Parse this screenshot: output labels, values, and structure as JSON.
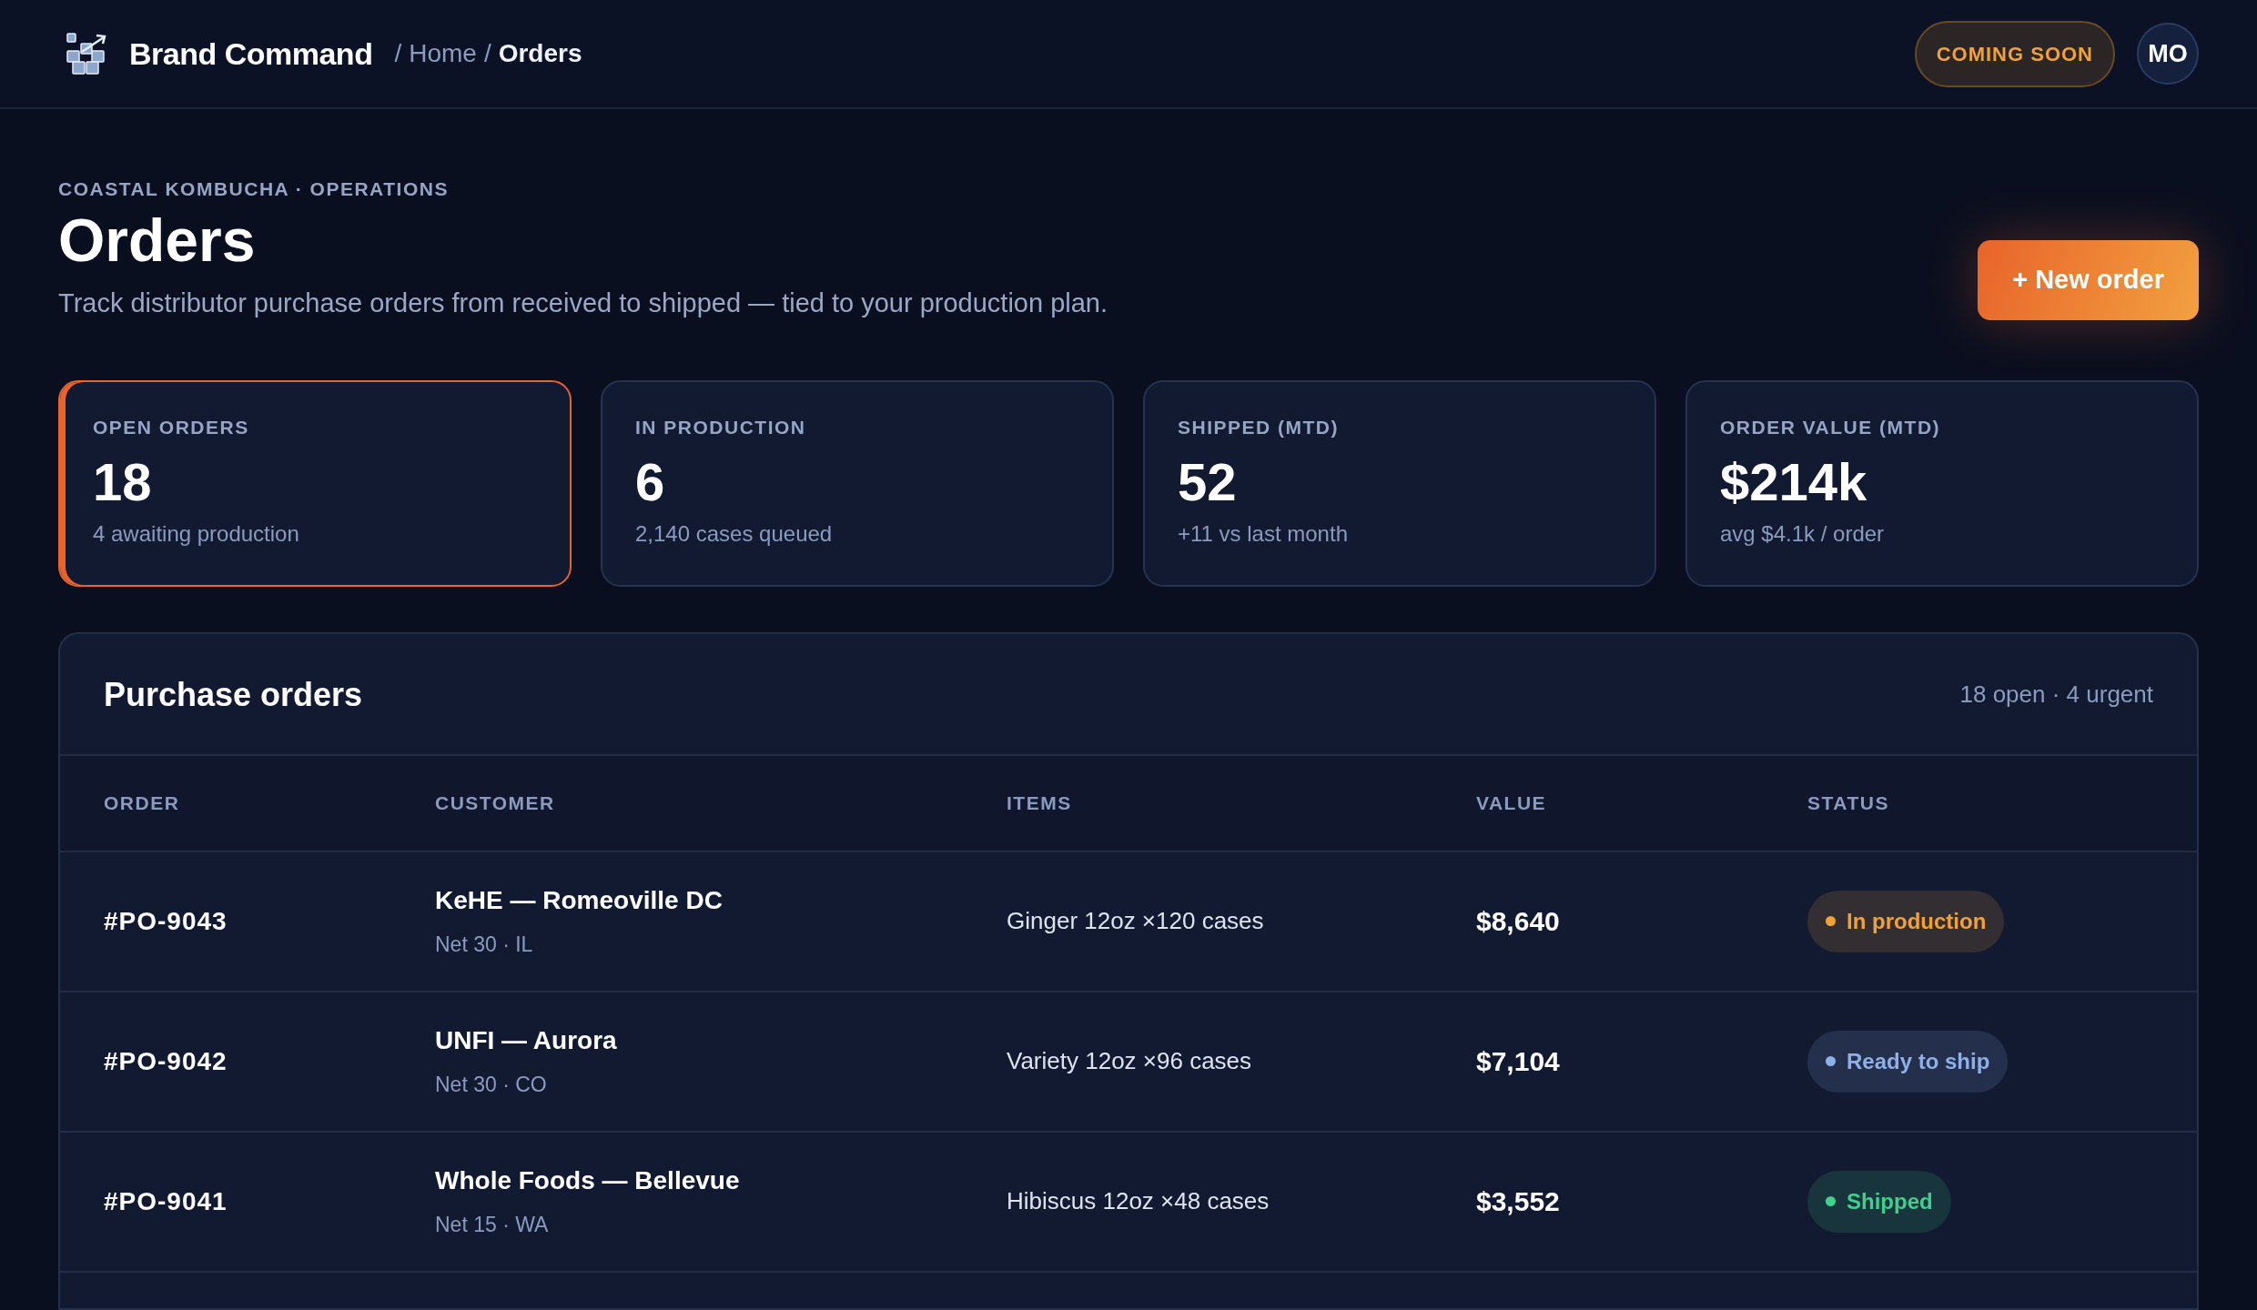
{
  "header": {
    "brand": "Brand Command",
    "breadcrumb": [
      {
        "separator": "/",
        "label": "Home",
        "current": false
      },
      {
        "separator": "/",
        "label": "Orders",
        "current": true
      }
    ],
    "badge": "COMING SOON",
    "avatar": "MO"
  },
  "page": {
    "eyebrow": "COASTAL KOMBUCHA · OPERATIONS",
    "title": "Orders",
    "subtitle": "Track distributor purchase orders from received to shipped — tied to your production plan.",
    "action": "+ New order"
  },
  "kpis": [
    {
      "label": "OPEN ORDERS",
      "value": "18",
      "note": "4 awaiting production",
      "selected": true
    },
    {
      "label": "IN PRODUCTION",
      "value": "6",
      "note": "2,140 cases queued",
      "selected": false
    },
    {
      "label": "SHIPPED (MTD)",
      "value": "52",
      "note": "+11 vs last month",
      "selected": false
    },
    {
      "label": "ORDER VALUE (MTD)",
      "value": "$214k",
      "note": "avg $4.1k / order",
      "selected": false
    }
  ],
  "table": {
    "title": "Purchase orders",
    "summary": "18 open · 4 urgent",
    "columns": [
      "ORDER",
      "CUSTOMER",
      "ITEMS",
      "VALUE",
      "STATUS"
    ],
    "rows": [
      {
        "order": "#PO-9043",
        "customer": "KeHE — Romeoville DC",
        "terms": "Net 30 · IL",
        "items": "Ginger 12oz ×120 cases",
        "value": "$8,640",
        "status": "In production",
        "color": "#f0a23a"
      },
      {
        "order": "#PO-9042",
        "customer": "UNFI — Aurora",
        "terms": "Net 30 · CO",
        "items": "Variety 12oz ×96 cases",
        "value": "$7,104",
        "status": "Ready to ship",
        "color": "#8fb0e6"
      },
      {
        "order": "#PO-9041",
        "customer": "Whole Foods — Bellevue",
        "terms": "Net 15 · WA",
        "items": "Hibiscus 12oz ×48 cases",
        "value": "$3,552",
        "status": "Shipped",
        "color": "#3ed08c"
      }
    ]
  }
}
